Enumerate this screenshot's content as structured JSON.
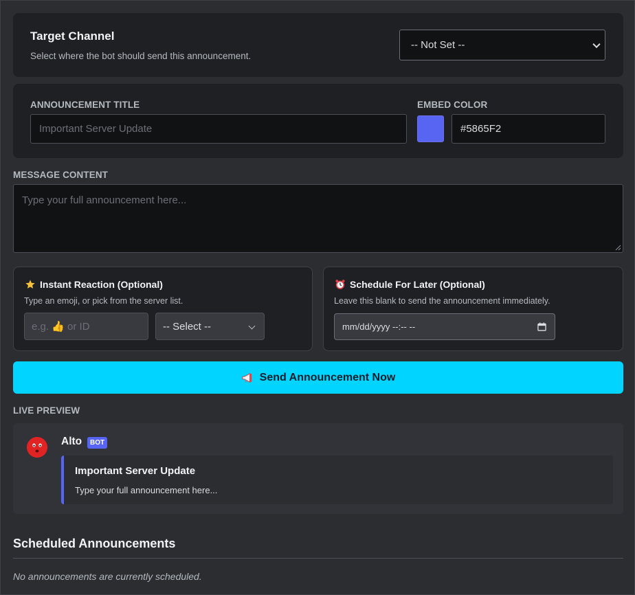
{
  "target_channel": {
    "title": "Target Channel",
    "description": "Select where the bot should send this announcement.",
    "selected": "-- Not Set --"
  },
  "announcement": {
    "title_label": "ANNOUNCEMENT TITLE",
    "title_placeholder": "Important Server Update",
    "color_label": "EMBED COLOR",
    "color_value": "#5865F2",
    "swatch_color": "#5865F2"
  },
  "message": {
    "label": "MESSAGE CONTENT",
    "placeholder": "Type your full announcement here..."
  },
  "reaction": {
    "icon": "star-icon",
    "title": "Instant Reaction (Optional)",
    "description": "Type an emoji, or pick from the server list.",
    "input_placeholder": "e.g. 👍 or ID",
    "select_value": "-- Select --"
  },
  "schedule": {
    "icon": "alarm-clock-icon",
    "title": "Schedule For Later (Optional)",
    "description": "Leave this blank to send the announcement immediately.",
    "datetime_placeholder": "mm/dd/yyyy --:-- --"
  },
  "send_button": {
    "icon": "megaphone-icon",
    "label": "Send Announcement Now",
    "color": "#00d4ff"
  },
  "preview": {
    "label": "LIVE PREVIEW",
    "bot_name": "Alto",
    "bot_badge": "BOT",
    "embed_title": "Important Server Update",
    "embed_body": "Type your full announcement here..."
  },
  "scheduled": {
    "heading": "Scheduled Announcements",
    "empty_text": "No announcements are currently scheduled."
  }
}
